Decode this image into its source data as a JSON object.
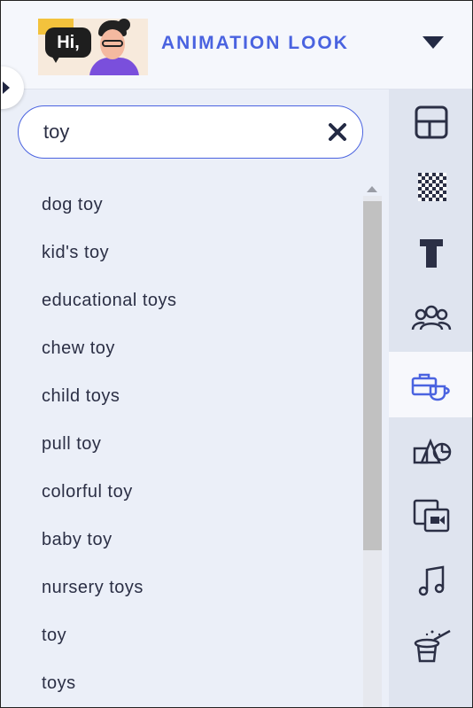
{
  "header": {
    "thumbnail_text": "Hi,",
    "title": "ANIMATION LOOK",
    "dropdown_icon": "caret-down-icon"
  },
  "search": {
    "value": "toy",
    "clear_icon": "close-icon"
  },
  "results": [
    "dog toy",
    "kid's toy",
    "educational toys",
    "chew toy",
    "child toys",
    "pull toy",
    "colorful toy",
    "baby toy",
    "nursery toys",
    "toy",
    "toys"
  ],
  "rail": {
    "items": [
      {
        "icon": "layout-icon",
        "active": false
      },
      {
        "icon": "background-pattern-icon",
        "active": false
      },
      {
        "icon": "text-icon",
        "active": false
      },
      {
        "icon": "characters-icon",
        "active": false
      },
      {
        "icon": "props-icon",
        "active": true
      },
      {
        "icon": "shapes-icon",
        "active": false
      },
      {
        "icon": "media-icon",
        "active": false
      },
      {
        "icon": "music-icon",
        "active": false
      },
      {
        "icon": "effects-icon",
        "active": false
      }
    ]
  },
  "colors": {
    "accent": "#4a63e0",
    "text": "#2b2f45",
    "panel": "#ebeff8",
    "rail": "#dfe4ef"
  }
}
